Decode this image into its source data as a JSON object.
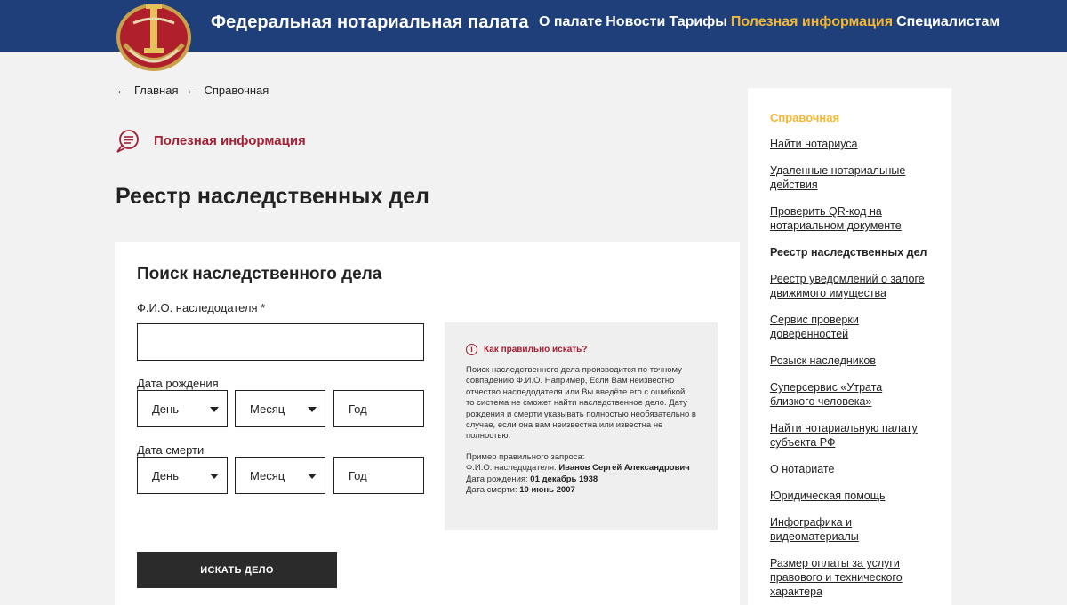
{
  "header": {
    "site_title": "Федеральная нотариальная палата",
    "nav": [
      {
        "label": "О палате",
        "active": false
      },
      {
        "label": "Новости",
        "active": false
      },
      {
        "label": "Тарифы",
        "active": false
      },
      {
        "label": "Полезная информация",
        "active": true
      },
      {
        "label": "Специалистам",
        "active": false
      }
    ]
  },
  "breadcrumb": [
    "Главная",
    "Справочная"
  ],
  "section_label": "Полезная информация",
  "page_title": "Реестр наследственных дел",
  "form": {
    "title": "Поиск наследственного дела",
    "name_label": "Ф.И.О. наследодателя *",
    "name_value": "",
    "birth_label": "Дата рождения",
    "death_label": "Дата смерти",
    "day": "День",
    "month": "Месяц",
    "year_placeholder": "Год",
    "submit": "ИСКАТЬ ДЕЛО"
  },
  "help": {
    "title": "Как правильно искать?",
    "text": "Поиск наследственного дела производится по точному совпадению Ф.И.О. Например, Если Вам неизвестно отчество наследодателя или Вы введёте его с ошибкой, то система не сможет найти наследственное дело. Дату рождения и смерти указывать полностью необязательно в случае, если она вам неизвестна или известна не полностью.",
    "example_intro": "Пример правильного запроса:",
    "example_name_label": "Ф.И.О. наследодателя: ",
    "example_name": "Иванов Сергей Александрович",
    "example_birth_label": "Дата рождения: ",
    "example_birth": "01 декабрь 1938",
    "example_death_label": "Дата смерти: ",
    "example_death": "10 июнь 2007"
  },
  "sidebar": {
    "heading": "Справочная",
    "items": [
      {
        "label": "Найти нотариуса",
        "current": false
      },
      {
        "label": "Удаленные нотариальные действия",
        "current": false
      },
      {
        "label": "Проверить QR-код на нотариальном документе",
        "current": false
      },
      {
        "label": "Реестр наследственных дел",
        "current": true
      },
      {
        "label": "Реестр уведомлений о залоге движимого имущества",
        "current": false
      },
      {
        "label": "Сервис проверки доверенностей",
        "current": false
      },
      {
        "label": "Розыск наследников",
        "current": false
      },
      {
        "label": "Суперсервис «Утрата близкого человека»",
        "current": false
      },
      {
        "label": "Найти нотариальную палату субъекта РФ",
        "current": false
      },
      {
        "label": "О нотариате",
        "current": false
      },
      {
        "label": "Юридическая помощь",
        "current": false
      },
      {
        "label": "Инфографика и видеоматериалы",
        "current": false
      },
      {
        "label": "Размер оплаты за услуги правового и технического характера",
        "current": false
      }
    ]
  },
  "colors": {
    "header_bg": "#1e3f7a",
    "accent_yellow": "#f5b731",
    "accent_red": "#a32035"
  }
}
